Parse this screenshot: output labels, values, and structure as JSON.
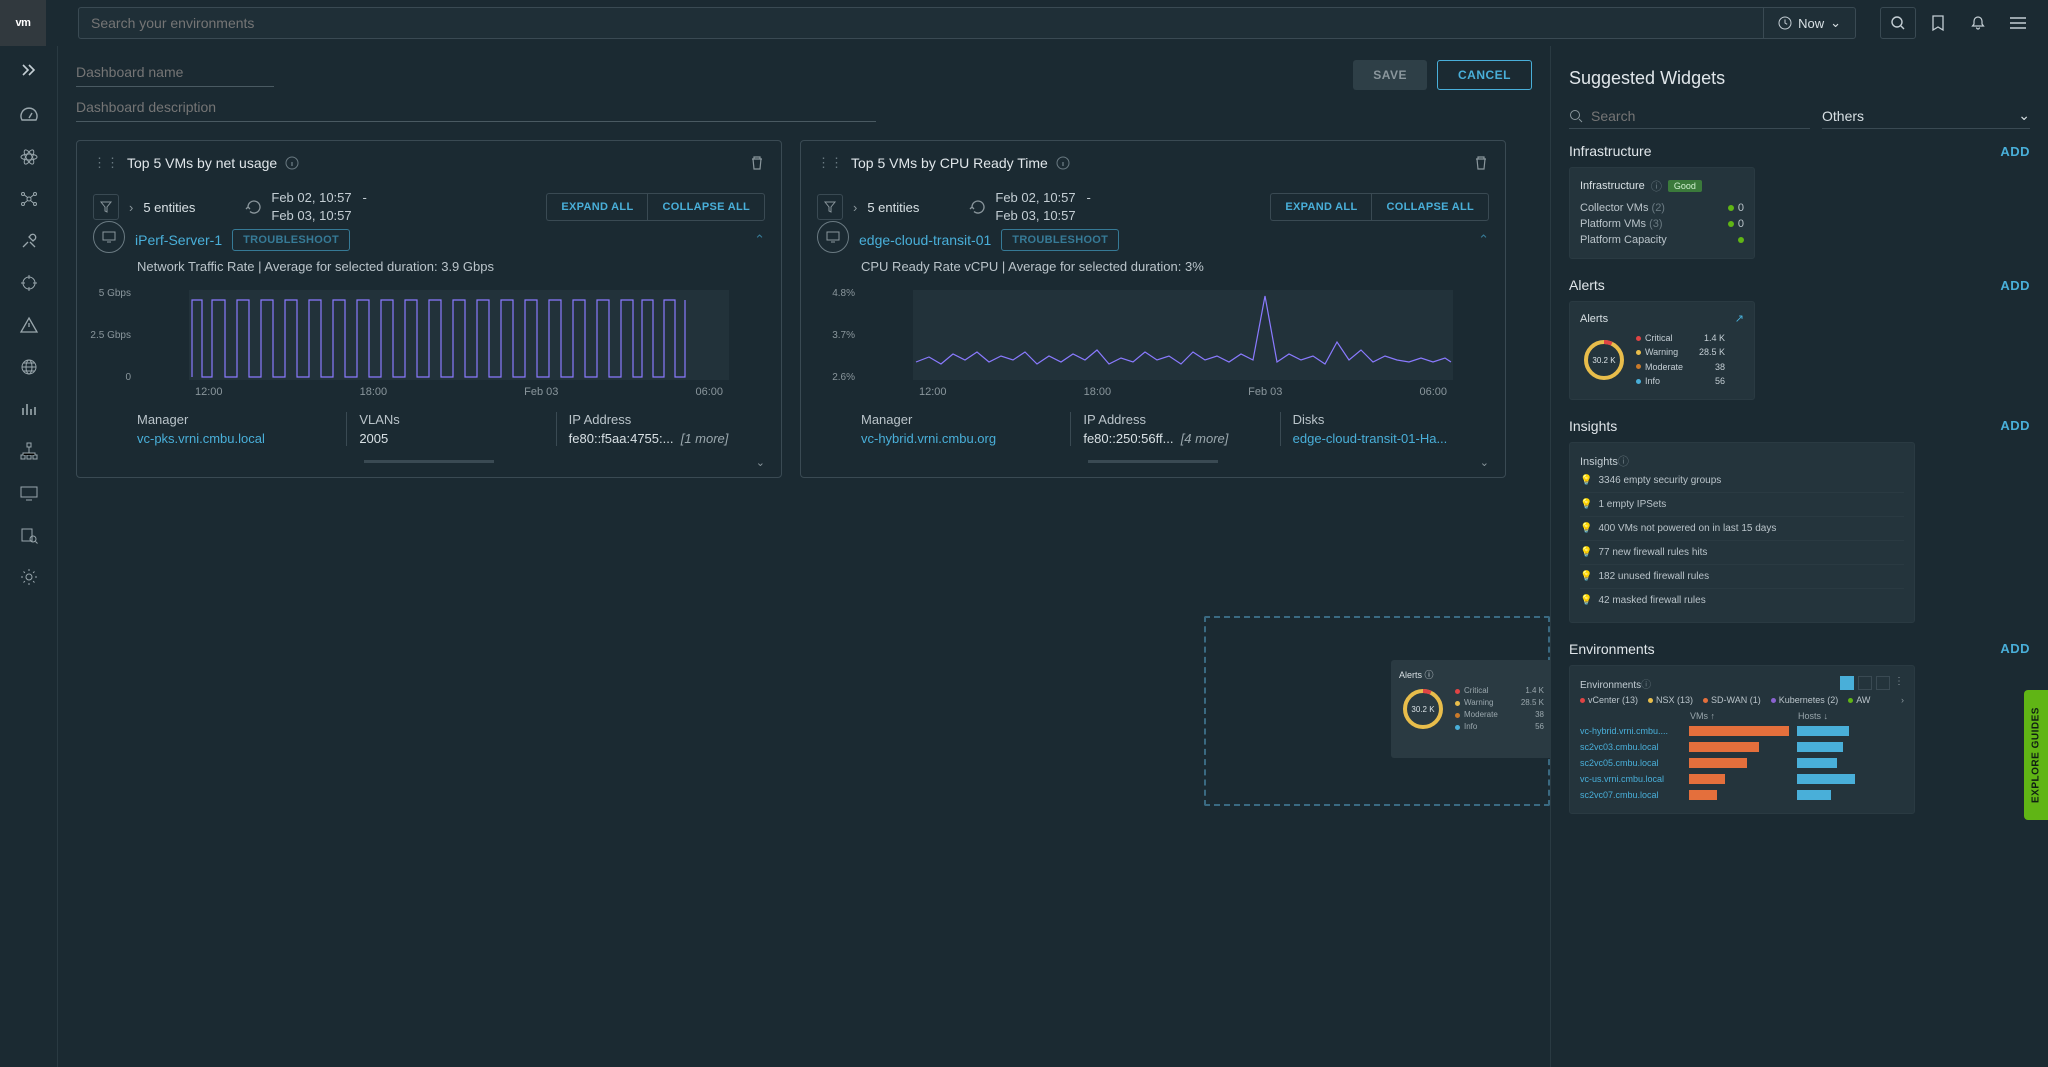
{
  "top": {
    "brand": "vm",
    "search_placeholder": "Search your environments",
    "now_label": "Now"
  },
  "dash": {
    "name_placeholder": "Dashboard name",
    "desc_placeholder": "Dashboard description",
    "save": "SAVE",
    "cancel": "CANCEL"
  },
  "widget1": {
    "title": "Top 5 VMs by net usage",
    "entities": "5 entities",
    "date_from": "Feb 02, 10:57",
    "date_sep": "-",
    "date_to": "Feb 03, 10:57",
    "expand": "EXPAND ALL",
    "collapse": "COLLAPSE ALL",
    "vm_name": "iPerf-Server-1",
    "tshoot": "TROUBLESHOOT",
    "metric": "Network Traffic Rate   |   Average for selected duration: 3.9 Gbps",
    "y_top": "5 Gbps",
    "y_mid": "2.5 Gbps",
    "y_bot": "0",
    "x_labels": [
      "12:00",
      "18:00",
      "Feb 03",
      "06:00"
    ],
    "d_manager_label": "Manager",
    "d_manager_val": "vc-pks.vrni.cmbu.local",
    "d_vlans_label": "VLANs",
    "d_vlans_val": "2005",
    "d_ip_label": "IP Address",
    "d_ip_val": "fe80::f5aa:4755:...",
    "d_ip_more": "[1 more]"
  },
  "widget2": {
    "title": "Top 5 VMs by CPU Ready Time",
    "entities": "5 entities",
    "date_from": "Feb 02, 10:57",
    "date_sep": "-",
    "date_to": "Feb 03, 10:57",
    "expand": "EXPAND ALL",
    "collapse": "COLLAPSE ALL",
    "vm_name": "edge-cloud-transit-01",
    "tshoot": "TROUBLESHOOT",
    "metric": "CPU Ready Rate vCPU   |   Average for selected duration: 3%",
    "y_top": "4.8%",
    "y_mid": "3.7%",
    "y_bot": "2.6%",
    "x_labels": [
      "12:00",
      "18:00",
      "Feb 03",
      "06:00"
    ],
    "d_manager_label": "Manager",
    "d_manager_val": "vc-hybrid.vrni.cmbu.org",
    "d_ip_label": "IP Address",
    "d_ip_val": "fe80::250:56ff...",
    "d_ip_more": "[4 more]",
    "d_disks_label": "Disks",
    "d_disks_val": "edge-cloud-transit-01-Ha..."
  },
  "ghost": {
    "title": "Alerts",
    "donut_val": "30.2 K",
    "legend": [
      {
        "name": "Critical",
        "val": "1.4 K",
        "color": "#e04444"
      },
      {
        "name": "Warning",
        "val": "28.5 K",
        "color": "#e8bd4b"
      },
      {
        "name": "Moderate",
        "val": "38",
        "color": "#c97a2a"
      },
      {
        "name": "Info",
        "val": "56",
        "color": "#49afd9"
      }
    ]
  },
  "side": {
    "title": "Suggested Widgets",
    "search_placeholder": "Search",
    "filter_label": "Others",
    "add": "ADD",
    "sec_infra": "Infrastructure",
    "infra_card": {
      "title": "Infrastructure",
      "badge": "Good",
      "rows": [
        {
          "label": "Collector VMs",
          "count": "(2)",
          "val": "0"
        },
        {
          "label": "Platform VMs",
          "count": "(3)",
          "val": "0"
        },
        {
          "label": "Platform Capacity",
          "count": "",
          "val": ""
        }
      ]
    },
    "sec_alerts": "Alerts",
    "alerts_card": {
      "title": "Alerts",
      "donut_val": "30.2 K",
      "legend": [
        {
          "name": "Critical",
          "val": "1.4 K",
          "color": "#e04444"
        },
        {
          "name": "Warning",
          "val": "28.5 K",
          "color": "#e8bd4b"
        },
        {
          "name": "Moderate",
          "val": "38",
          "color": "#c97a2a"
        },
        {
          "name": "Info",
          "val": "56",
          "color": "#49afd9"
        }
      ]
    },
    "sec_insights": "Insights",
    "insights_card": {
      "title": "Insights",
      "rows": [
        "3346 empty security groups",
        "1 empty IPSets",
        "400 VMs not powered on in last 15 days",
        "77 new firewall rules hits",
        "182 unused firewall rules",
        "42 masked firewall rules"
      ]
    },
    "sec_env": "Environments",
    "env_card": {
      "title": "Environments",
      "tags": [
        {
          "name": "vCenter (13)",
          "color": "#e04444"
        },
        {
          "name": "NSX (13)",
          "color": "#e8bd4b"
        },
        {
          "name": "SD-WAN (1)",
          "color": "#e46f3c"
        },
        {
          "name": "Kubernetes (2)",
          "color": "#8a62d0"
        },
        {
          "name": "AW",
          "color": "#60b515"
        }
      ],
      "col_vms": "VMs ↑",
      "col_hosts": "Hosts ↓",
      "rows": [
        {
          "name": "vc-hybrid.vrni.cmbu....",
          "vms_w": 100,
          "hosts_w": 52
        },
        {
          "name": "sc2vc03.cmbu.local",
          "vms_w": 70,
          "hosts_w": 46
        },
        {
          "name": "sc2vc05.cmbu.local",
          "vms_w": 58,
          "hosts_w": 40
        },
        {
          "name": "vc-us.vrni.cmbu.local",
          "vms_w": 36,
          "hosts_w": 58
        },
        {
          "name": "sc2vc07.cmbu.local",
          "vms_w": 28,
          "hosts_w": 34
        }
      ]
    }
  },
  "explore": "EXPLORE GUIDES",
  "chart_data": [
    {
      "type": "line",
      "title": "Network Traffic Rate",
      "ylabel": "Gbps",
      "ylim": [
        0,
        5
      ],
      "x": [
        "12:00",
        "18:00",
        "Feb 03",
        "06:00"
      ],
      "series": [
        {
          "name": "iPerf-Server-1",
          "values_note": "square-wave pattern oscillating roughly between 0-0.2 Gbps and 4.2-4.6 Gbps with ~30 cycles across 24h; average 3.9 Gbps"
        }
      ]
    },
    {
      "type": "line",
      "title": "CPU Ready Rate vCPU",
      "ylabel": "%",
      "ylim": [
        2.6,
        4.8
      ],
      "x": [
        "12:00",
        "18:00",
        "Feb 03",
        "06:00"
      ],
      "series": [
        {
          "name": "edge-cloud-transit-01",
          "values_note": "noisy line centered ~3% with one spike to ~4.7% near Feb 03 and several small spikes 3.3-3.6%"
        }
      ]
    }
  ]
}
